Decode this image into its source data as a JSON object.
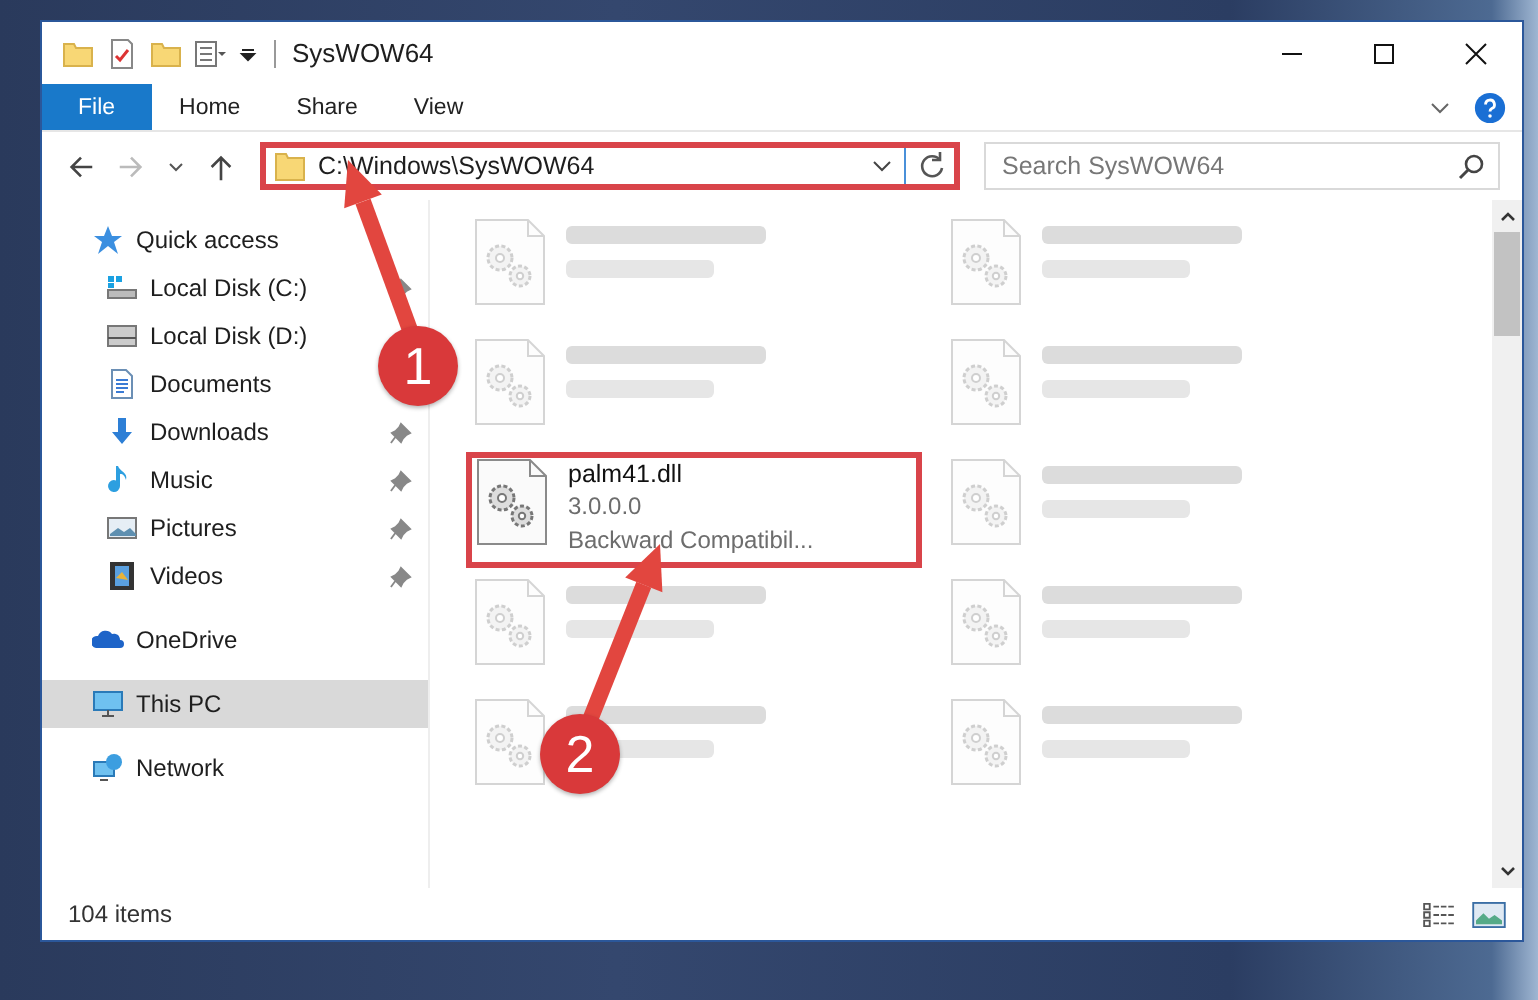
{
  "window": {
    "title": "SysWOW64"
  },
  "ribbon": {
    "tabs": [
      {
        "label": "File",
        "selected": true
      },
      {
        "label": "Home",
        "selected": false
      },
      {
        "label": "Share",
        "selected": false
      },
      {
        "label": "View",
        "selected": false
      }
    ]
  },
  "address": {
    "path": "C:\\Windows\\SysWOW64",
    "highlighted": true
  },
  "search": {
    "placeholder": "Search SysWOW64"
  },
  "nav": {
    "items": [
      {
        "label": "Quick access",
        "kind": "star",
        "selected": false,
        "children": [
          {
            "label": "Local Disk (C:)",
            "kind": "drive-c",
            "pinned": true,
            "selected": false
          },
          {
            "label": "Local Disk (D:)",
            "kind": "drive",
            "pinned": false,
            "selected": false
          },
          {
            "label": "Documents",
            "kind": "documents",
            "pinned": false,
            "selected": false
          },
          {
            "label": "Downloads",
            "kind": "downloads",
            "pinned": true,
            "selected": false
          },
          {
            "label": "Music",
            "kind": "music",
            "pinned": true,
            "selected": false
          },
          {
            "label": "Pictures",
            "kind": "pictures",
            "pinned": true,
            "selected": false
          },
          {
            "label": "Videos",
            "kind": "videos",
            "pinned": true,
            "selected": false
          }
        ]
      },
      {
        "label": "OneDrive",
        "kind": "cloud",
        "selected": false
      },
      {
        "label": "This PC",
        "kind": "pc",
        "selected": true
      },
      {
        "label": "Network",
        "kind": "network",
        "selected": false
      }
    ]
  },
  "files": [
    {
      "kind": "blurred",
      "highlighted": false
    },
    {
      "kind": "blurred",
      "highlighted": false
    },
    {
      "kind": "blurred",
      "highlighted": false
    },
    {
      "kind": "blurred",
      "highlighted": false
    },
    {
      "kind": "file",
      "name": "palm41.dll",
      "lines": [
        "3.0.0.0",
        "Backward Compatibil..."
      ],
      "highlighted": true
    },
    {
      "kind": "blurred",
      "highlighted": false
    },
    {
      "kind": "blurred",
      "highlighted": false
    },
    {
      "kind": "blurred",
      "highlighted": false
    },
    {
      "kind": "blurred",
      "highlighted": false
    },
    {
      "kind": "blurred",
      "highlighted": false
    }
  ],
  "status_bar": {
    "count": "104 items"
  },
  "annotations": [
    {
      "number": "1"
    },
    {
      "number": "2"
    }
  ]
}
